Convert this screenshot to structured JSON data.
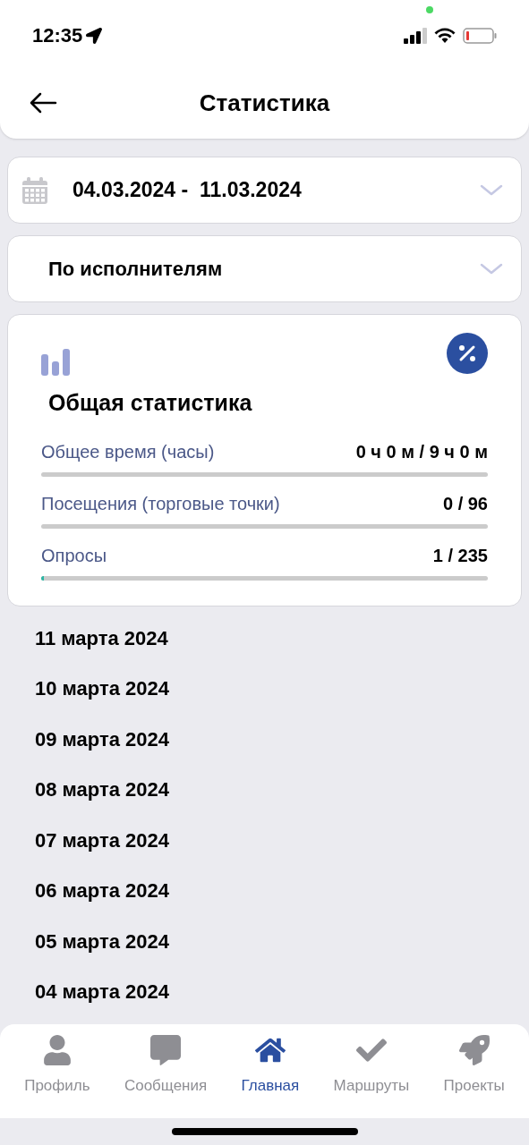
{
  "status_bar": {
    "time": "12:35"
  },
  "header": {
    "title": "Статистика"
  },
  "date_range": {
    "start": "04.03.2024",
    "separator": "-",
    "end": "11.03.2024"
  },
  "grouping": {
    "value": "По исполнителям"
  },
  "summary": {
    "title": "Общая статистика",
    "rows": [
      {
        "label": "Общее время (часы)",
        "value": "0 ч 0 м / 9 ч 0 м"
      },
      {
        "label": "Посещения (торговые точки)",
        "value": "0 / 96"
      },
      {
        "label": "Опросы",
        "value": "1 / 235",
        "level": 0.004
      }
    ]
  },
  "days": [
    "11 марта 2024",
    "10 марта 2024",
    "09 марта 2024",
    "08 марта 2024",
    "07 марта 2024",
    "06 марта 2024",
    "05 марта 2024",
    "04 марта 2024"
  ],
  "tab_bar": [
    {
      "label": "Профиль",
      "selected": false
    },
    {
      "label": "Сообщения",
      "selected": false
    },
    {
      "label": "Главная",
      "selected": true
    },
    {
      "label": "Маршруты",
      "selected": false
    },
    {
      "label": "Проекты",
      "selected": false
    }
  ]
}
